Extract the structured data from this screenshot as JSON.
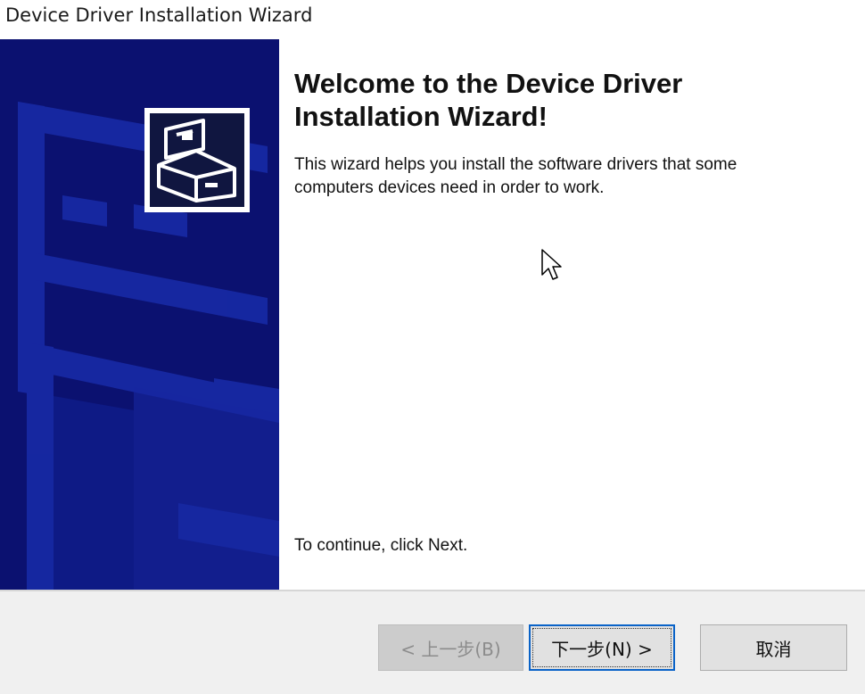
{
  "window": {
    "title": "Device Driver Installation Wizard"
  },
  "main": {
    "heading": "Welcome to the Device Driver Installation Wizard!",
    "description": "This wizard helps you install the software drivers that some computers devices need in order to work.",
    "continue_text": "To continue, click Next."
  },
  "buttons": {
    "back_label": "< 上一步(B)",
    "next_label": "下一步(N) >",
    "cancel_label": "取消"
  },
  "colors": {
    "banner": "#0b1170",
    "focus_border": "#0a63c8"
  },
  "icons": [
    "computer-case-icon",
    "mouse-cursor-icon"
  ]
}
